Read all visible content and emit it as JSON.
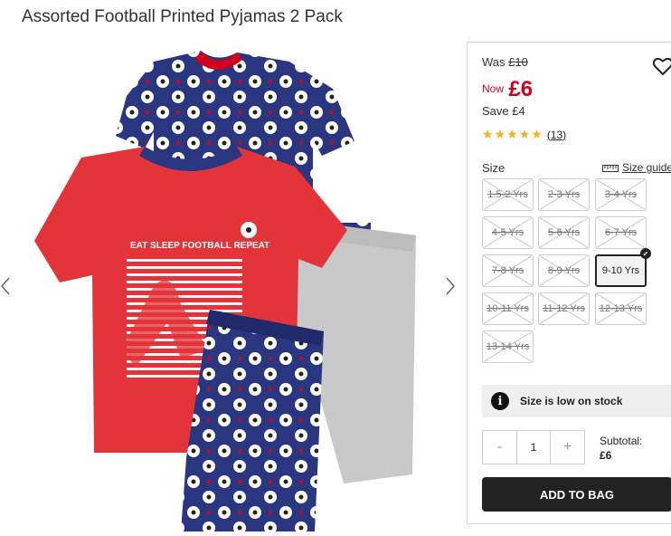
{
  "product": {
    "title": "Assorted Football Printed Pyjamas 2 Pack"
  },
  "gallery": {
    "tshirt_text": "EAT SLEEP FOOTBALL REPEAT"
  },
  "price": {
    "was_label": "Was",
    "was_value": "£10",
    "now_label": "Now",
    "now_value": "£6",
    "save_label": "Save",
    "save_value": "£4",
    "accent_color": "#d0021b"
  },
  "rating": {
    "stars": 5,
    "count": "(13)"
  },
  "size": {
    "label": "Size",
    "guide_label": "Size guide",
    "options": [
      {
        "label": "1.5-2 Yrs",
        "available": false
      },
      {
        "label": "2-3 Yrs",
        "available": false
      },
      {
        "label": "3-4 Yrs",
        "available": false
      },
      {
        "label": "4-5 Yrs",
        "available": false
      },
      {
        "label": "5-6 Yrs",
        "available": false
      },
      {
        "label": "6-7 Yrs",
        "available": false
      },
      {
        "label": "7-8 Yrs",
        "available": false
      },
      {
        "label": "8-9 Yrs",
        "available": false
      },
      {
        "label": "9-10 Yrs",
        "available": true,
        "selected": true
      },
      {
        "label": "10-11 Yrs",
        "available": false
      },
      {
        "label": "11-12 Yrs",
        "available": false
      },
      {
        "label": "12-13 Yrs",
        "available": false
      },
      {
        "label": "13-14 Yrs",
        "available": false
      }
    ]
  },
  "stock": {
    "message": "Size is low on stock",
    "icon": "info-icon"
  },
  "quantity": {
    "minus": "-",
    "value": "1",
    "plus": "+"
  },
  "subtotal": {
    "label": "Subtotal:",
    "value": "£6"
  },
  "cart": {
    "add_label": "ADD TO BAG"
  }
}
